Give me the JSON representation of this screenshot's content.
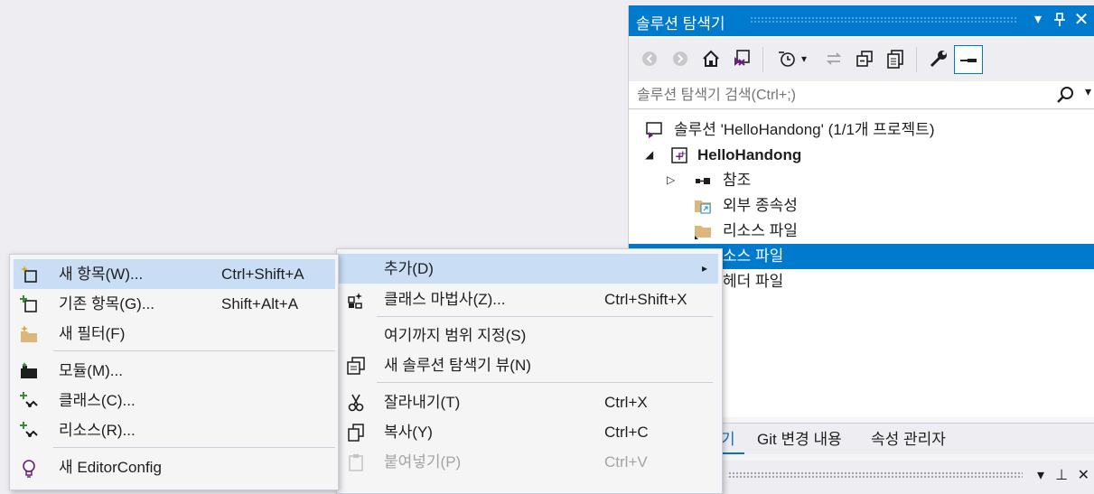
{
  "solution_explorer": {
    "title": "솔루션 탐색기",
    "search_placeholder": "솔루션 탐색기 검색(Ctrl+;)",
    "tree": {
      "solution": "솔루션 'HelloHandong' (1/1개 프로젝트)",
      "project": "HelloHandong",
      "references": "참조",
      "external_deps": "외부 종속성",
      "resource_files": "리소스 파일",
      "source_files": "소스 파일",
      "header_files": "헤더 파일"
    },
    "tabs": [
      "솔루션 탐색기",
      "Git 변경 내용",
      "속성 관리자"
    ],
    "active_tab_visible": "기"
  },
  "context_menu": {
    "items": [
      {
        "label": "추가(D)",
        "shortcut": "",
        "submenu_arrow": "▸"
      },
      {
        "label": "클래스 마법사(Z)...",
        "shortcut": "Ctrl+Shift+X"
      },
      {
        "label": "여기까지 범위 지정(S)",
        "shortcut": ""
      },
      {
        "label": "새 솔루션 탐색기 뷰(N)",
        "shortcut": ""
      },
      {
        "label": "잘라내기(T)",
        "shortcut": "Ctrl+X"
      },
      {
        "label": "복사(Y)",
        "shortcut": "Ctrl+C"
      },
      {
        "label": "붙여넣기(P)",
        "shortcut": "Ctrl+V"
      }
    ]
  },
  "add_submenu": {
    "items": [
      {
        "label": "새 항목(W)...",
        "shortcut": "Ctrl+Shift+A"
      },
      {
        "label": "기존 항목(G)...",
        "shortcut": "Shift+Alt+A"
      },
      {
        "label": "새 필터(F)",
        "shortcut": ""
      },
      {
        "label": "모듈(M)...",
        "shortcut": ""
      },
      {
        "label": "클래스(C)...",
        "shortcut": ""
      },
      {
        "label": "리소스(R)...",
        "shortcut": ""
      },
      {
        "label": "새 EditorConfig",
        "shortcut": ""
      }
    ]
  },
  "colors": {
    "accent": "#007acc",
    "highlight": "#c9ddf5",
    "menu_bg": "#f5f5f5"
  }
}
